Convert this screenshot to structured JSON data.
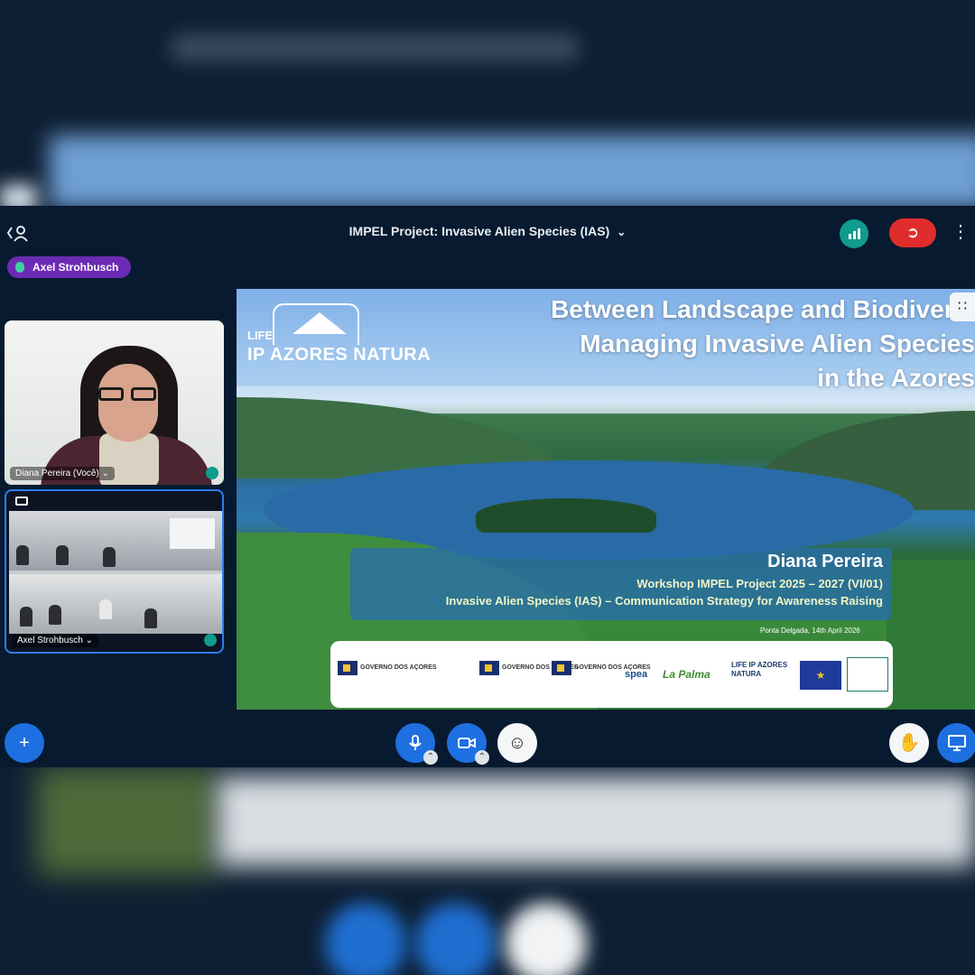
{
  "meeting": {
    "title": "IMPEL Project: Invasive Alien Species (IAS)",
    "active_speaker": "Axel Strohbusch"
  },
  "participants": [
    {
      "name": "Diana Pereira (Você)"
    },
    {
      "name": "Axel Strohbusch"
    }
  ],
  "slide": {
    "logo_life": "LIFE",
    "logo_name": "IP AZORES NATURA",
    "title_lines": [
      "Between Landscape and Biodiversi",
      "Managing Invasive Alien Species",
      "in the Azores"
    ],
    "presenter": "Diana Pereira",
    "workshop": "Workshop IMPEL Project 2025 – 2027 (VI/01)",
    "topic": "Invasive Alien Species (IAS) – Communication Strategy for Awareness Raising",
    "place_date": "Ponta Delgada, 14th April 2026",
    "logos": {
      "gov1": "GOVERNO DOS AÇORES",
      "gov2": "GOVERNO DOS AÇORES",
      "gov3": "GOVERNO DOS AÇORES",
      "spea": "spea",
      "lapalma": "La Palma",
      "life": "LIFE IP AZORES NATURA"
    }
  },
  "colors": {
    "window_bg": "#071a2f",
    "accent_blue": "#1e6fe0",
    "leave_red": "#e12c2c",
    "speaker_purple": "#6c2bb5",
    "signal_teal": "#0f9b8e"
  },
  "icons": {
    "back": "back-user-icon",
    "signal": "signal-icon",
    "leave": "leave-icon",
    "more": "more-vertical-icon",
    "mic": "mic-icon",
    "camera": "camera-icon",
    "emoji": "emoji-icon",
    "hand": "raise-hand-icon",
    "share": "present-screen-icon",
    "add": "add-icon"
  }
}
